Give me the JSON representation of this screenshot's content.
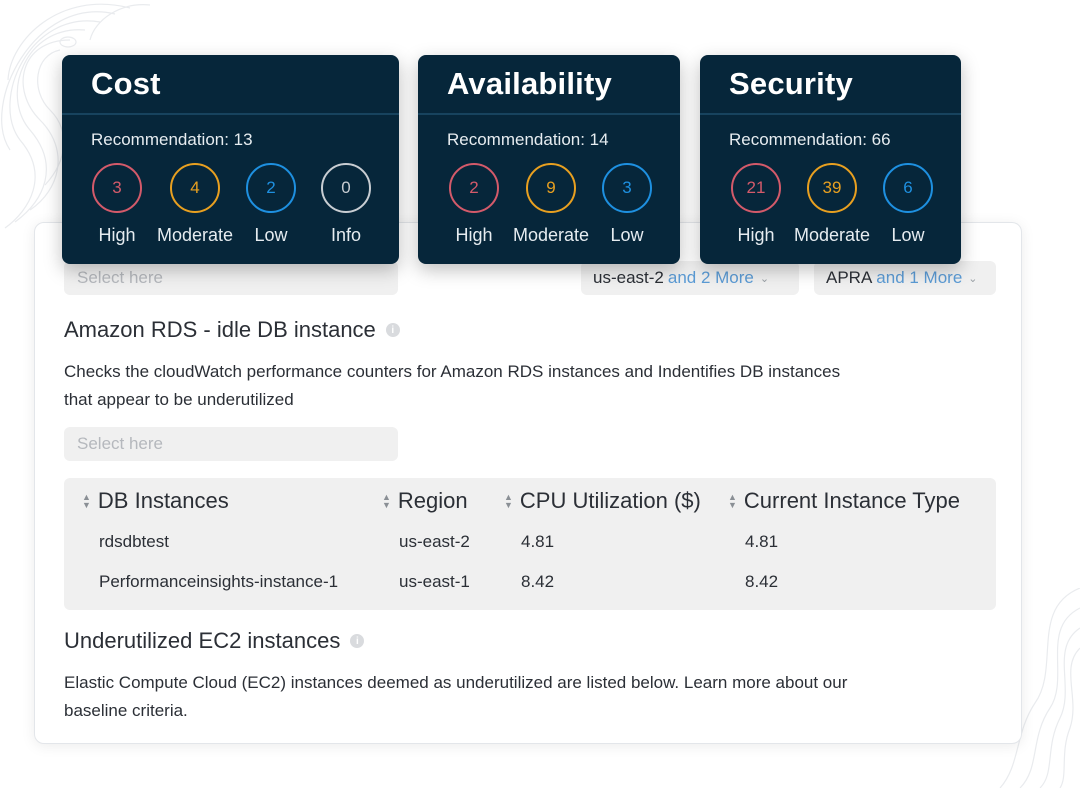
{
  "colors": {
    "card_bg": "#06263a",
    "high": "#d35a6a",
    "moderate": "#e8a020",
    "low": "#1e90e0",
    "info": "#c8cdd2",
    "link": "#5b9bd5"
  },
  "cards": [
    {
      "title": "Cost",
      "recommendation": "Recommendation: 13",
      "levels": [
        {
          "label": "High",
          "count": "3",
          "severity": "high"
        },
        {
          "label": "Moderate",
          "count": "4",
          "severity": "moderate"
        },
        {
          "label": "Low",
          "count": "2",
          "severity": "low"
        },
        {
          "label": "Info",
          "count": "0",
          "severity": "info"
        }
      ]
    },
    {
      "title": "Availability",
      "recommendation": "Recommendation: 14",
      "levels": [
        {
          "label": "High",
          "count": "2",
          "severity": "high"
        },
        {
          "label": "Moderate",
          "count": "9",
          "severity": "moderate"
        },
        {
          "label": "Low",
          "count": "3",
          "severity": "low"
        }
      ]
    },
    {
      "title": "Security",
      "recommendation": "Recommendation: 66",
      "levels": [
        {
          "label": "High",
          "count": "21",
          "severity": "high"
        },
        {
          "label": "Moderate",
          "count": "39",
          "severity": "moderate"
        },
        {
          "label": "Low",
          "count": "6",
          "severity": "low"
        }
      ]
    }
  ],
  "filters": {
    "top_select_placeholder": "Select here",
    "region": {
      "value": "us-east-2",
      "more": "and 2 More"
    },
    "compliance": {
      "value": "APRA",
      "more": "and 1 More"
    }
  },
  "rds": {
    "title": "Amazon RDS - idle DB instance",
    "description_line1": "Checks the cloudWatch performance counters for Amazon RDS instances and Indentifies DB instances",
    "description_line2": "that appear to be underutilized",
    "select_placeholder": "Select here",
    "table": {
      "headers": [
        "DB Instances",
        "Region",
        "CPU Utilization ($)",
        "Current Instance Type"
      ],
      "rows": [
        [
          "rdsdbtest",
          "us-east-2",
          "4.81",
          "4.81"
        ],
        [
          "Performanceinsights-instance-1",
          "us-east-1",
          "8.42",
          "8.42"
        ]
      ]
    }
  },
  "ec2": {
    "title": "Underutilized EC2 instances",
    "description_line1": "Elastic Compute Cloud (EC2) instances deemed as underutilized are listed below. Learn more about our",
    "description_line2": "baseline criteria."
  }
}
